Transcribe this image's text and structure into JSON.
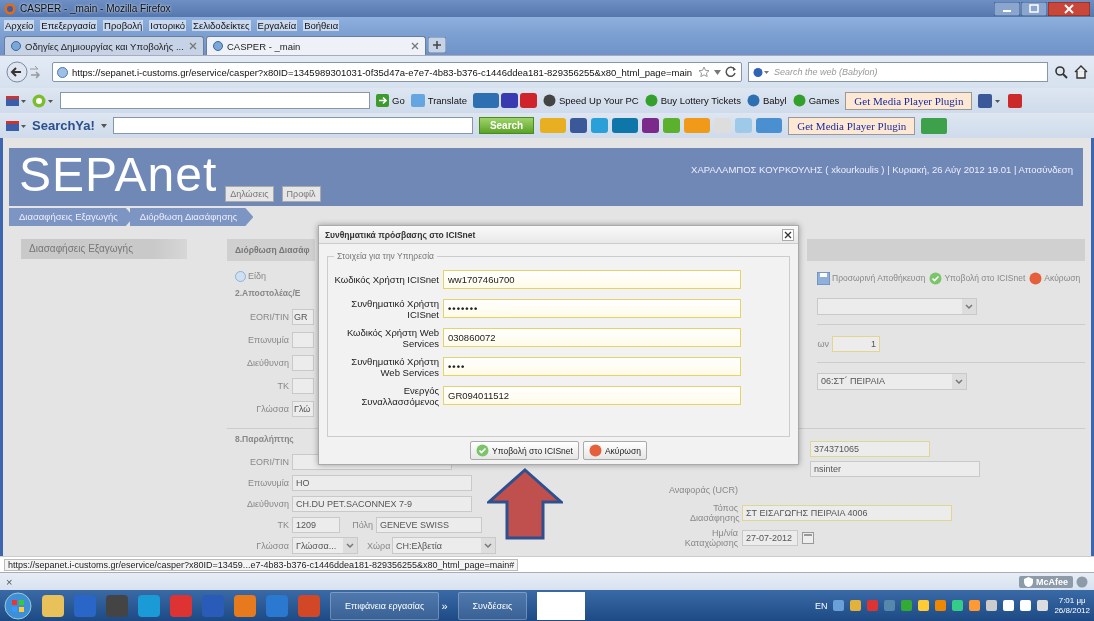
{
  "window": {
    "title": "CASPER - _main - Mozilla Firefox"
  },
  "menu": [
    "Αρχείο",
    "Επεξεργασία",
    "Προβολή",
    "Ιστορικό",
    "Σελιδοδείκτες",
    "Εργαλεία",
    "Βοήθεια"
  ],
  "tabs": [
    {
      "label": "Οδηγίες Δημιουργίας και Υποβολής ...",
      "selected": false
    },
    {
      "label": "CASPER - _main",
      "selected": true
    }
  ],
  "address_bar": {
    "url": "https://sepanet.i-customs.gr/eservice/casper?x80ID=1345989301031-0f35d47a-e7e7-4b83-b376-c1446ddea181-829356255&x80_html_page=main"
  },
  "search": {
    "placeholder": "Search the web (Babylon)"
  },
  "toolbar_1": {
    "go": "Go",
    "translate": "Translate",
    "links": [
      "Speed Up Your PC",
      "Buy Lottery Tickets",
      "Babyl",
      "Games"
    ],
    "plugin": "Get Media Player Plugin"
  },
  "toolbar_2": {
    "brand": "SearchYa!",
    "search_button": "Search",
    "plugin": "Get Media Player Plugin"
  },
  "site": {
    "logo": "SEPAnet",
    "nav": [
      "Δηλώσεις",
      "Προφίλ"
    ],
    "user": "ΧΑΡΑΛΑΜΠΟΣ ΚΟΥΡΚΟΥΛΗΣ ( xkourkoulis ) | Κυριακή, 26 Αύγ 2012 19.01 |",
    "logout": "Αποσύνδεση"
  },
  "breadcrumb": [
    "Διασαφήσεις Εξαγωγής",
    "Διόρθωση Διασάφησης"
  ],
  "sidebar": {
    "title": "Διασαφήσεις Εξαγωγής"
  },
  "form": {
    "title": "Διόρθωση Διασάφ",
    "items_link": "Είδη",
    "actions": [
      {
        "label": "Προσωρινή Αποθήκευση",
        "kind": "save"
      },
      {
        "label": "Υποβολή στο ICISnet",
        "kind": "submit"
      },
      {
        "label": "Ακύρωση",
        "kind": "cancel"
      }
    ],
    "sender": {
      "heading": "2.Αποστολέας/Ε",
      "fields": [
        {
          "label": "EORI/TIN",
          "value": "GR"
        },
        {
          "label": "Επωνυμία"
        },
        {
          "label": "Διεύθυνση"
        },
        {
          "label": "ΤΚ"
        },
        {
          "label": "Γλώσσα",
          "value": "Γλώ"
        }
      ]
    },
    "count": {
      "label": "ων",
      "value": "1"
    },
    "office": {
      "value": "06:ΣΤ΄ ΠΕΙΡΑΙΑ"
    },
    "receiver": {
      "heading": "8.Παραλήπτης",
      "eori_label": "EORI/TIN",
      "name_label": "Επωνυμία",
      "name_value": "HO",
      "address_label": "Διεύθυνση",
      "address_value": "CH.DU PET.SACONNEX 7-9",
      "zip_label": "ΤΚ",
      "zip_value": "1209",
      "city_label": "Πόλη",
      "city_value": "GENEVE SWISS",
      "language_label": "Γλώσσα",
      "language_value": "Γλώσσα...",
      "country_label": "Χώρα",
      "country_value": "CH:Ελβετία"
    },
    "right": {
      "reference_number": "374371065",
      "field_2": "nsinter",
      "ucr_label": "Αναφοράς (UCR)",
      "place_label": "Τόπος Διασάφησης",
      "place_value": "ΣΤ ΕΙΣΑΓΩΓΗΣ ΠΕΙΡΑΙΑ 4006",
      "date_label": "Ημ/νία Καταχώρισης",
      "date_value": "27-07-2012"
    }
  },
  "dialog": {
    "title": "Συνθηματικά πρόσβασης στο ICISnet",
    "legend": "Στοιχεία για την Υπηρεσία",
    "fields": [
      {
        "label": "Κωδικός Χρήστη ICISnet",
        "value": "ww170746u700",
        "kind": "text"
      },
      {
        "label": "Συνθηματικό Χρήστη ICISnet",
        "value": "•••••••",
        "kind": "password"
      },
      {
        "label": "Κωδικός Χρήστη Web Services",
        "value": "030860072",
        "kind": "text"
      },
      {
        "label": "Συνθηματικό Χρήστη Web Services",
        "value": "••••",
        "kind": "password"
      },
      {
        "label": "Ενεργός Συναλλασσόμενος",
        "value": "GR094011512",
        "kind": "text"
      }
    ],
    "buttons": [
      {
        "label": "Υποβολή στο ICISnet",
        "kind": "submit"
      },
      {
        "label": "Ακύρωση",
        "kind": "cancel"
      }
    ]
  },
  "status_bar": {
    "url": "https://sepanet.i-customs.gr/eservice/casper?x80ID=13459...e7-4b83-b376-c1446ddea181-829356255&x80_html_page=main#"
  },
  "addon_bar": {
    "close": "×",
    "security": "McAfee"
  },
  "taskbar": {
    "items": [
      "Επιφάνεια εργασίας",
      "Συνδέσεις"
    ],
    "overflow": "»",
    "language": "EN",
    "time": "7:01 μμ",
    "date": "26/8/2012"
  }
}
